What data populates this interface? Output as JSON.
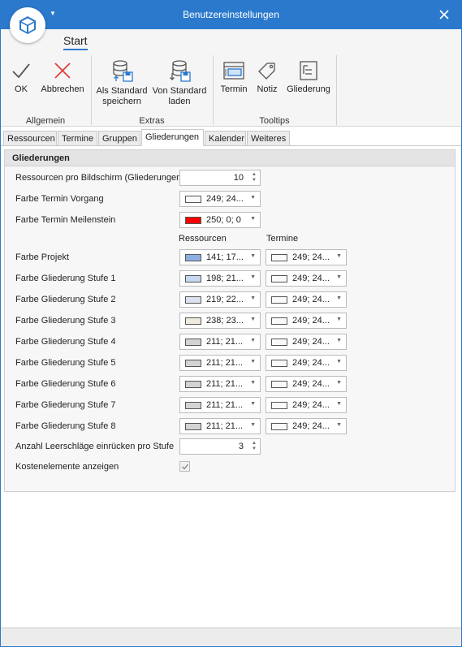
{
  "window": {
    "title": "Benutzereinstellungen"
  },
  "ribbon": {
    "tab": "Start",
    "buttons": {
      "ok": "OK",
      "cancel": "Abbrechen",
      "save_default": "Als Standard speichern",
      "load_default": "Von Standard laden",
      "appointment": "Termin",
      "note": "Notiz",
      "outline": "Gliederung"
    },
    "groups": {
      "general": "Allgemein",
      "extras": "Extras",
      "tooltips": "Tooltips"
    }
  },
  "tabs": [
    "Ressourcen",
    "Termine",
    "Gruppen",
    "Gliederungen",
    "Kalender",
    "Weiteres"
  ],
  "active_tab": "Gliederungen",
  "section": {
    "title": "Gliederungen",
    "col_headers": {
      "resources": "Ressourcen",
      "appointments": "Termine"
    },
    "resources_per_screen": {
      "label": "Ressourcen pro Bildschirm (Gliederungen)",
      "value": "10"
    },
    "appointment_process_color": {
      "label": "Farbe Termin Vorgang",
      "value": "249; 24...",
      "color": "#f9f9f9"
    },
    "appointment_milestone_color": {
      "label": "Farbe Termin Meilenstein",
      "value": "250; 0; 0",
      "color": "#fa0000"
    },
    "rows": [
      {
        "label": "Farbe Projekt",
        "res_value": "141; 17...",
        "res_color": "#8daee0",
        "term_value": "249; 24...",
        "term_color": "#f9f9f9"
      },
      {
        "label": "Farbe Gliederung Stufe 1",
        "res_value": "198; 21...",
        "res_color": "#c6d9f0",
        "term_value": "249; 24...",
        "term_color": "#f9f9f9"
      },
      {
        "label": "Farbe Gliederung Stufe 2",
        "res_value": "219; 22...",
        "res_color": "#dbe3ef",
        "term_value": "249; 24...",
        "term_color": "#f9f9f9"
      },
      {
        "label": "Farbe Gliederung Stufe 3",
        "res_value": "238; 23...",
        "res_color": "#eeeade",
        "term_value": "249; 24...",
        "term_color": "#f9f9f9"
      },
      {
        "label": "Farbe Gliederung Stufe 4",
        "res_value": "211; 21...",
        "res_color": "#d3d3d3",
        "term_value": "249; 24...",
        "term_color": "#f9f9f9"
      },
      {
        "label": "Farbe Gliederung Stufe 5",
        "res_value": "211; 21...",
        "res_color": "#d3d3d3",
        "term_value": "249; 24...",
        "term_color": "#f9f9f9"
      },
      {
        "label": "Farbe Gliederung Stufe 6",
        "res_value": "211; 21...",
        "res_color": "#d3d3d3",
        "term_value": "249; 24...",
        "term_color": "#f9f9f9"
      },
      {
        "label": "Farbe Gliederung Stufe 7",
        "res_value": "211; 21...",
        "res_color": "#d3d3d3",
        "term_value": "249; 24...",
        "term_color": "#f9f9f9"
      },
      {
        "label": "Farbe Gliederung Stufe 8",
        "res_value": "211; 21...",
        "res_color": "#d3d3d3",
        "term_value": "249; 24...",
        "term_color": "#f9f9f9"
      }
    ],
    "indent_spaces": {
      "label": "Anzahl Leerschläge einrücken pro Stufe",
      "value": "3"
    },
    "show_cost_elements": {
      "label": "Kostenelemente anzeigen",
      "checked": true
    }
  },
  "colors": {
    "accent": "#2b79cc",
    "cancel_red": "#e0403a"
  }
}
